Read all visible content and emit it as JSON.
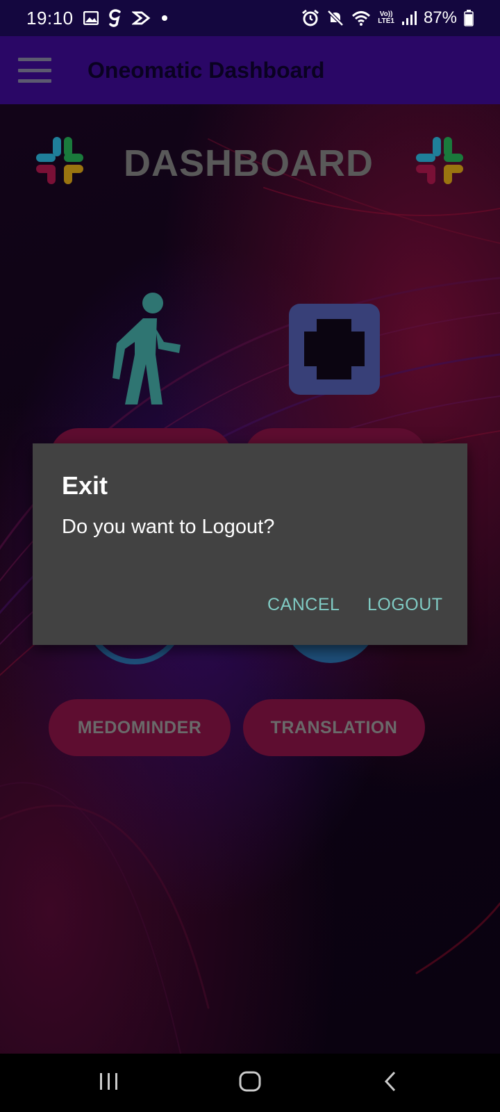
{
  "status_bar": {
    "time": "19:10",
    "left_icons": [
      "gallery-icon",
      "g-app-icon",
      "dotlink-icon",
      "dot-icon"
    ],
    "right_icons": [
      "alarm-icon",
      "mute-icon",
      "wifi-icon",
      "volte-icon",
      "signal-icon"
    ],
    "volte_top": "Vo))",
    "volte_bottom": "LTE1",
    "battery_percent": "87%",
    "battery_level": 0.87
  },
  "app_bar": {
    "title": "Oneomatic Dashboard"
  },
  "dashboard": {
    "title": "DASHBOARD",
    "buttons_row2": {
      "left_label": "MEDOMINDER",
      "right_label": "TRANSLATION"
    }
  },
  "dialog": {
    "title": "Exit",
    "message": "Do you want to Logout?",
    "cancel_label": "CANCEL",
    "logout_label": "LOGOUT"
  },
  "colors": {
    "accent_teal": "#80cbc4",
    "app_bar": "#2a0766",
    "button_bg": "#5e0d30",
    "dialog_bg": "#424242"
  }
}
